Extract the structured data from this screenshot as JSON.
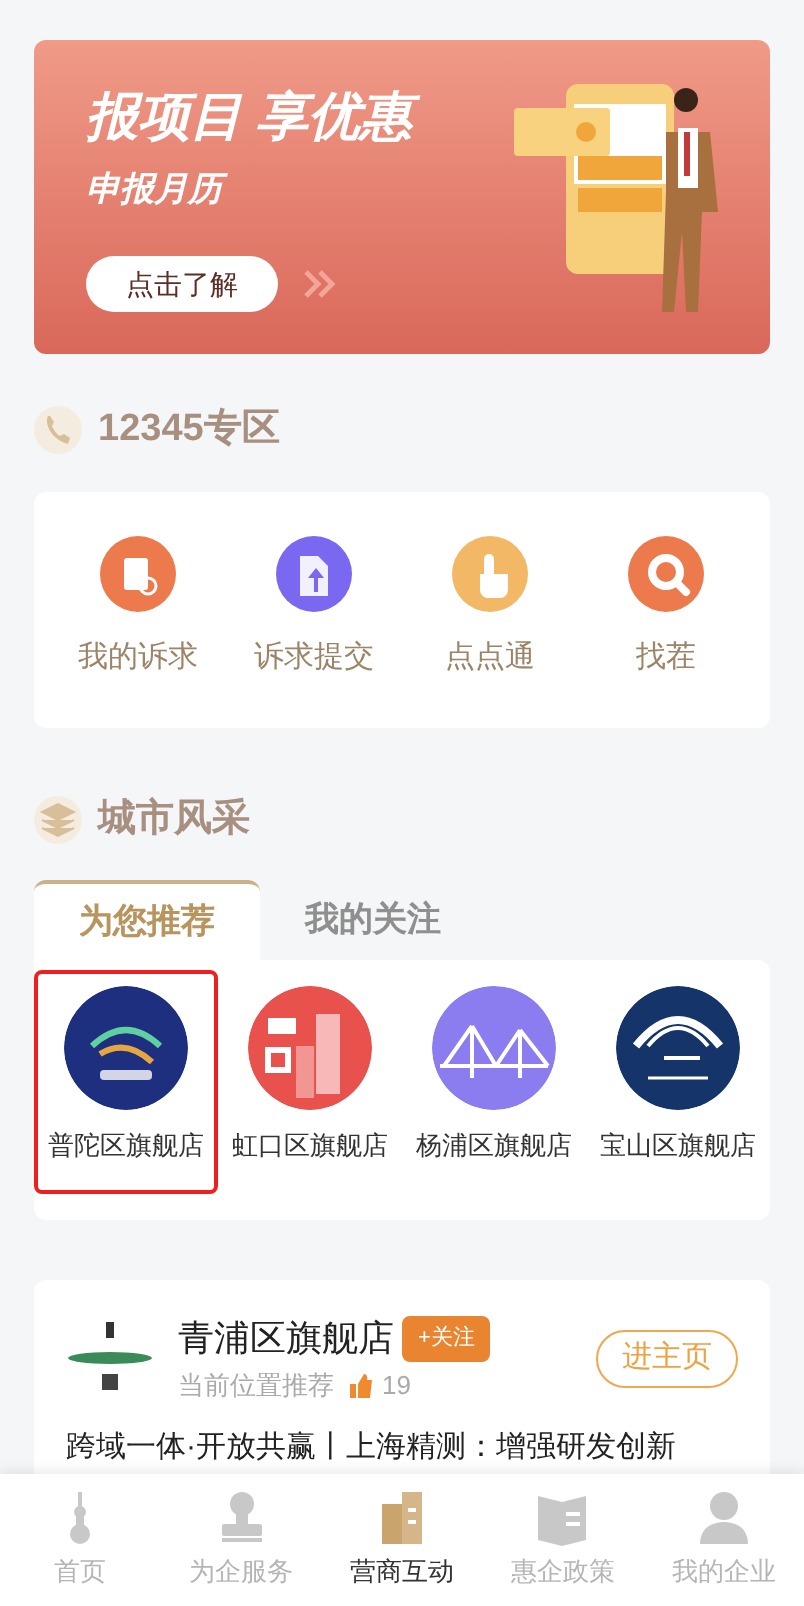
{
  "banner": {
    "title": "报项目 享优惠",
    "subtitle": "申报月历",
    "button": "点击了解"
  },
  "hotline": {
    "title": "12345专区",
    "items": [
      {
        "label": "我的诉求",
        "kind": "complaint",
        "color": "#ec7a4c"
      },
      {
        "label": "诉求提交",
        "kind": "submit",
        "color": "#7b68f0"
      },
      {
        "label": "点点通",
        "kind": "tap",
        "color": "#f2b865"
      },
      {
        "label": "找茬",
        "kind": "search",
        "color": "#ec7a4c"
      }
    ]
  },
  "city": {
    "title": "城市风采",
    "tabs": [
      {
        "label": "为您推荐",
        "selected": true
      },
      {
        "label": "我的关注",
        "selected": false
      }
    ],
    "stores": [
      {
        "label": "普陀区旗舰店",
        "selected": true,
        "color": "#1f2f80"
      },
      {
        "label": "虹口区旗舰店",
        "selected": false,
        "color": "#e9514d"
      },
      {
        "label": "杨浦区旗舰店",
        "selected": false,
        "color": "#8b7cf0"
      },
      {
        "label": "宝山区旗舰店",
        "selected": false,
        "color": "#15356a"
      }
    ]
  },
  "feature": {
    "name": "青浦区旗舰店",
    "follow": "+关注",
    "note": "当前位置推荐",
    "likes": "19",
    "home_button": "进主页",
    "headline": "跨域一体·开放共赢丨上海精测：增强研发创新"
  },
  "nav": [
    {
      "label": "首页",
      "selected": false,
      "kind": "tower"
    },
    {
      "label": "为企服务",
      "selected": false,
      "kind": "stamp"
    },
    {
      "label": "营商互动",
      "selected": true,
      "kind": "building"
    },
    {
      "label": "惠企政策",
      "selected": false,
      "kind": "book"
    },
    {
      "label": "我的企业",
      "selected": false,
      "kind": "person"
    }
  ]
}
